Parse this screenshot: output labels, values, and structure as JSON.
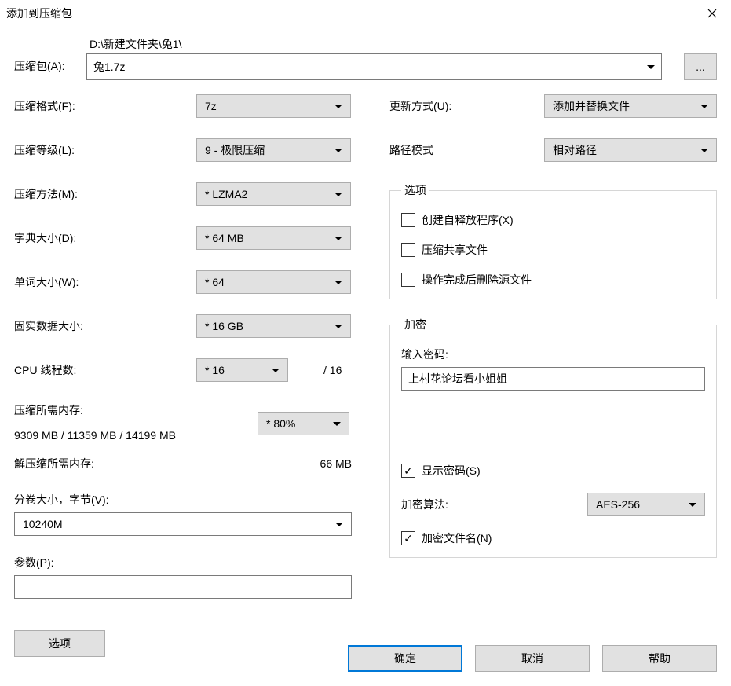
{
  "window": {
    "title": "添加到压缩包"
  },
  "archive": {
    "label": "压缩包(A):",
    "path": "D:\\新建文件夹\\兔1\\",
    "filename": "兔1.7z",
    "browse": "..."
  },
  "left": {
    "format_label": "压缩格式(F):",
    "format_value": "7z",
    "level_label": "压缩等级(L):",
    "level_value": "9 - 极限压缩",
    "method_label": "压缩方法(M):",
    "method_value": "*  LZMA2",
    "dict_label": "字典大小(D):",
    "dict_value": "*  64 MB",
    "word_label": "单词大小(W):",
    "word_value": "*  64",
    "solid_label": "固实数据大小:",
    "solid_value": "*  16 GB",
    "threads_label": "CPU 线程数:",
    "threads_value": "*  16",
    "threads_total": "/ 16",
    "mem_comp_label": "压缩所需内存:",
    "mem_comp_value": "9309 MB / 11359 MB / 14199 MB",
    "mem_pct_value": "*  80%",
    "mem_decomp_label": "解压缩所需内存:",
    "mem_decomp_value": "66 MB",
    "volume_label": "分卷大小，字节(V):",
    "volume_value": "10240M",
    "params_label": "参数(P):",
    "params_value": "",
    "options_btn": "选项"
  },
  "right": {
    "update_label": "更新方式(U):",
    "update_value": "添加并替换文件",
    "pathmode_label": "路径模式",
    "pathmode_value": "相对路径",
    "options_legend": "选项",
    "opt_sfx": "创建自释放程序(X)",
    "opt_shared": "压缩共享文件",
    "opt_delete": "操作完成后删除源文件",
    "enc_legend": "加密",
    "enc_pwd_label": "输入密码:",
    "enc_pwd_value": "上村花论坛看小姐姐",
    "enc_show": "显示密码(S)",
    "enc_alg_label": "加密算法:",
    "enc_alg_value": "AES-256",
    "enc_names": "加密文件名(N)"
  },
  "footer": {
    "ok": "确定",
    "cancel": "取消",
    "help": "帮助"
  }
}
